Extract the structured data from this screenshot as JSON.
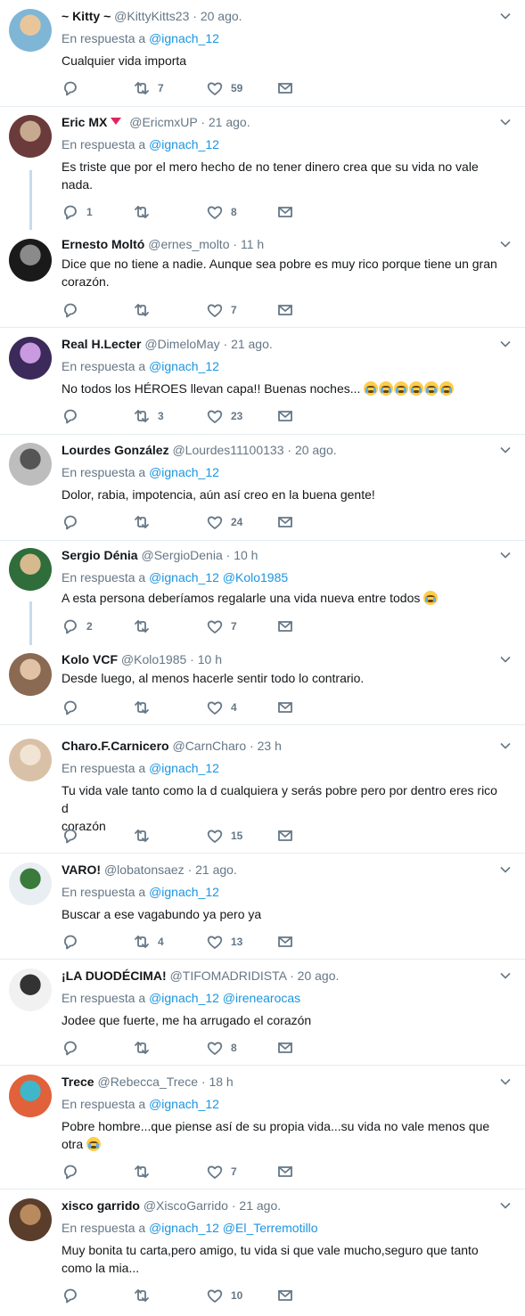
{
  "colors": {
    "link": "#1b95e0",
    "muted": "#657786",
    "separator": "#e6ecf0",
    "thread": "#c4dcee",
    "badge": "#e0245e"
  },
  "icons": {
    "reply": "reply-icon",
    "retweet": "retweet-icon",
    "like": "heart-icon",
    "dm": "envelope-icon",
    "menu": "chevron-down-icon"
  },
  "tweets": [
    {
      "name": "~ Kitty ~",
      "handle": "@KittyKitts23",
      "time": "20 ago.",
      "reply_prefix": "En respuesta a",
      "reply_to": "@ignach_12",
      "lines": [
        "Cualquier vida importa"
      ],
      "replies": "",
      "retweets": "7",
      "likes": "59",
      "avatar": [
        "#7fb6d6",
        "#e9c69a"
      ]
    },
    {
      "name": "Eric MX",
      "handle": "@EricmxUP",
      "time": "21 ago.",
      "badge": true,
      "reply_prefix": "En respuesta a",
      "reply_to": "@ignach_12",
      "lines": [
        "Es triste que por el mero hecho de no tener dinero crea que su vida no vale",
        "nada."
      ],
      "replies": "1",
      "retweets": "",
      "likes": "8",
      "avatar": [
        "#6b3a3a",
        "#c7a98f"
      ]
    },
    {
      "name": "Ernesto Moltó",
      "handle": "@ernes_molto",
      "time": "11 h",
      "lines": [
        "Dice que no tiene a nadie. Aunque sea pobre es muy rico porque tiene un gran",
        "corazón."
      ],
      "replies": "",
      "retweets": "",
      "likes": "7",
      "avatar": [
        "#1a1a1a",
        "#8a8a8a"
      ]
    },
    {
      "name": "Real H.Lecter",
      "handle": "@DimeloMay",
      "time": "21 ago.",
      "reply_prefix": "En respuesta a",
      "reply_to": "@ignach_12",
      "lines": [
        "No todos los HÉROES llevan capa!! Buenas noches..."
      ],
      "emoji_count": 6,
      "replies": "",
      "retweets": "3",
      "likes": "23",
      "avatar": [
        "#3b2a5a",
        "#c99ae0"
      ]
    },
    {
      "name": "Lourdes González",
      "handle": "@Lourdes11100133",
      "time": "20 ago.",
      "reply_prefix": "En respuesta a",
      "reply_to": "@ignach_12",
      "lines": [
        "Dolor, rabia, impotencia, aún así creo en la buena gente!"
      ],
      "replies": "",
      "retweets": "",
      "likes": "24",
      "avatar": [
        "#bdbdbd",
        "#555555"
      ]
    },
    {
      "name": "Sergio Dénia",
      "handle": "@SergioDenia",
      "time": "10 h",
      "reply_prefix": "En respuesta a",
      "reply_to": "@ignach_12 @Kolo1985",
      "lines": [
        "A esta persona deberíamos regalarle una vida nueva entre todos"
      ],
      "emoji_count": 1,
      "replies": "2",
      "retweets": "",
      "likes": "7",
      "avatar": [
        "#2f6d3b",
        "#d7b98e"
      ]
    },
    {
      "name": "Kolo VCF",
      "handle": "@Kolo1985",
      "time": "10 h",
      "lines": [
        "Desde luego, al menos hacerle sentir todo lo contrario."
      ],
      "replies": "",
      "retweets": "",
      "likes": "4",
      "avatar": [
        "#8a6a52",
        "#e0c3a6"
      ]
    },
    {
      "name": "Charo.F.Carnicero",
      "handle": "@CarnCharo",
      "time": "23 h",
      "reply_prefix": "En respuesta a",
      "reply_to": "@ignach_12",
      "lines": [
        "Tu vida vale tanto como la d cualquiera y serás pobre pero por dentro eres rico d",
        "corazón"
      ],
      "replies": "",
      "retweets": "",
      "likes": "15",
      "avatar": [
        "#d9c1a8",
        "#f2e4d4"
      ]
    },
    {
      "name": "VARO!",
      "handle": "@lobatonsaez",
      "time": "21 ago.",
      "reply_prefix": "En respuesta a",
      "reply_to": "@ignach_12",
      "lines": [
        "Buscar a ese vagabundo ya pero ya"
      ],
      "replies": "",
      "retweets": "4",
      "likes": "13",
      "avatar": [
        "#e9eef2",
        "#3a7a3a"
      ]
    },
    {
      "name": "¡LA DUODÉCIMA!",
      "handle": "@TIFOMADRIDISTA",
      "time": "20 ago.",
      "reply_prefix": "En respuesta a",
      "reply_to": "@ignach_12 @irenearocas",
      "lines": [
        "Jodee que fuerte, me ha arrugado el corazón"
      ],
      "replies": "",
      "retweets": "",
      "likes": "8",
      "avatar": [
        "#f1f1f1",
        "#333333"
      ]
    },
    {
      "name": "Trece",
      "handle": "@Rebecca_Trece",
      "time": "18 h",
      "reply_prefix": "En respuesta a",
      "reply_to": "@ignach_12",
      "lines": [
        "Pobre hombre...que piense así de su propia vida...su vida no vale menos que",
        "otra"
      ],
      "emoji_count": 1,
      "replies": "",
      "retweets": "",
      "likes": "7",
      "avatar": [
        "#e0613a",
        "#3fb6c9"
      ]
    },
    {
      "name": "xisco garrido",
      "handle": "@XiscoGarrido",
      "time": "21 ago.",
      "reply_prefix": "En respuesta a",
      "reply_to": "@ignach_12 @El_Terremotillo",
      "lines": [
        "Muy bonita tu carta,pero amigo, tu vida si que vale mucho,seguro que tanto",
        "como la mia..."
      ],
      "replies": "",
      "retweets": "",
      "likes": "10",
      "avatar": [
        "#5a3d2b",
        "#b88a5e"
      ]
    }
  ]
}
